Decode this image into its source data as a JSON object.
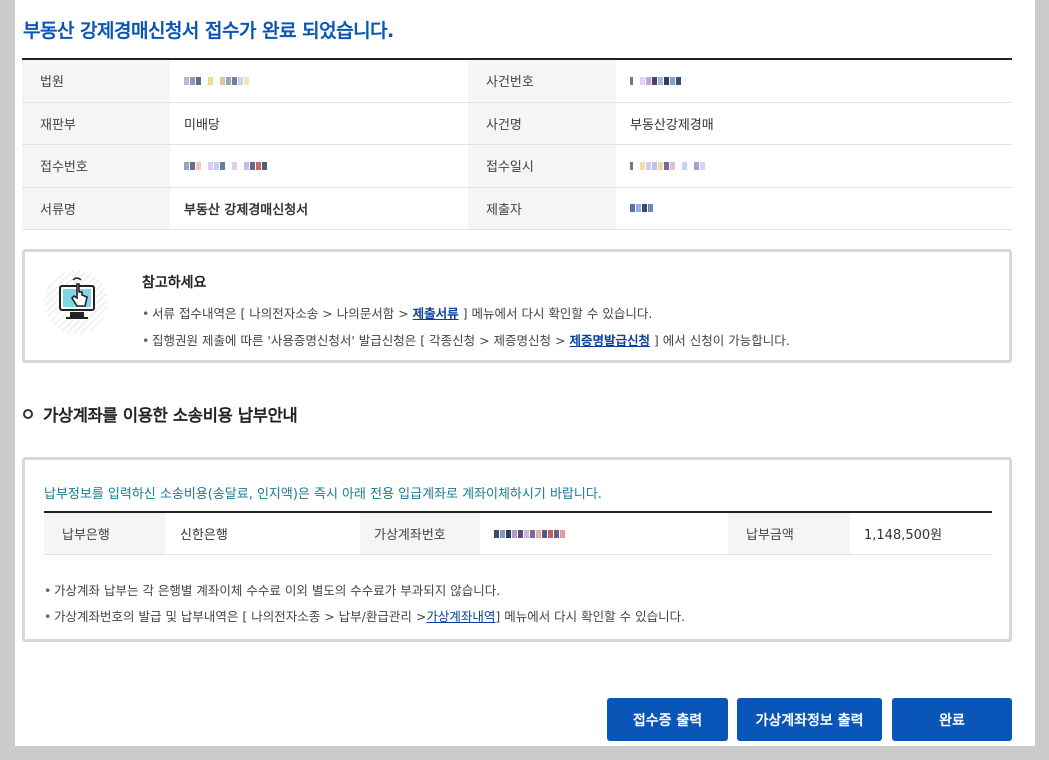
{
  "page": {
    "title": "부동산 강제경매신청서 접수가 완료 되었습니다."
  },
  "info": {
    "court_label": "법원",
    "case_no_label": "사건번호",
    "division_label": "재판부",
    "division_value": "미배당",
    "case_name_label": "사건명",
    "case_name_value": "부동산강제경매",
    "receipt_no_label": "접수번호",
    "receipt_date_label": "접수일시",
    "doc_name_label": "서류명",
    "doc_name_value": "부동산 강제경매신청서",
    "submitter_label": "제출자"
  },
  "notice": {
    "title": "참고하세요",
    "line1_prefix": "서류 접수내역은 [ 나의전자소송 > 나의문서함 > ",
    "line1_link": "제출서류",
    "line1_suffix": " ] 메뉴에서 다시 확인할 수 있습니다.",
    "line2_prefix": "집행권원 제출에 따른 '사용증명신청서' 발급신청은 [ 각종신청 > 제증명신청 > ",
    "line2_link": "제증명발급신청",
    "line2_suffix": " ] 에서 신청이 가능합니다."
  },
  "section": {
    "title": "가상계좌를 이용한 소송비용 납부안내"
  },
  "payment": {
    "guide": "납부정보를 입력하신 소송비용(송달료, 인지액)은 즉시 아래 전용 입급계좌로 계좌이체하시기 바랍니다.",
    "bank_label": "납부은행",
    "bank_value": "신한은행",
    "account_label": "가상계좌번호",
    "amount_label": "납부금액",
    "amount_value": "1,148,500원",
    "note1": "가상계좌 납부는 각 은행별 계좌이체 수수료 이외 별도의 수수료가 부과되지 않습니다.",
    "note2_prefix": "가상계좌번호의 발급 및 납부내역은 [ 나의전자소종 > 납부/환급관리 >",
    "note2_link": "가상계좌내역",
    "note2_suffix": "] 메뉴에서 다시 확인할 수 있습니다."
  },
  "buttons": {
    "receipt_print": "접수증 출력",
    "account_print": "가상계좌정보 출력",
    "done": "완료"
  },
  "colors": {
    "accent": "#0a56b8",
    "guide_text": "#1a7a92",
    "link": "#0a3f9a"
  }
}
